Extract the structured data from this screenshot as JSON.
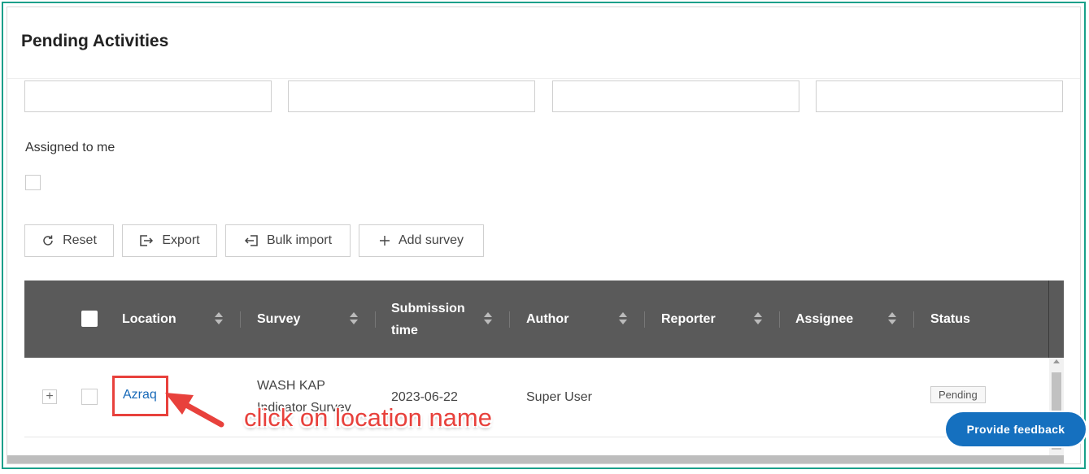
{
  "page": {
    "title": "Pending Activities"
  },
  "filters": {
    "inputs": [
      "",
      "",
      "",
      ""
    ],
    "assigned_label": "Assigned to me"
  },
  "toolbar": {
    "reset": "Reset",
    "export": "Export",
    "bulk_import": "Bulk import",
    "add_survey": "Add survey"
  },
  "table": {
    "columns": [
      "Location",
      "Survey",
      "Submission time",
      "Author",
      "Reporter",
      "Assignee",
      "Status"
    ],
    "column_lines": {
      "submission_1": "Submission",
      "submission_2": "time"
    },
    "rows": [
      {
        "location": "Azraq",
        "survey_line1": "WASH KAP",
        "survey_line2": "Indicator Survey",
        "submission_time": "2023-06-22",
        "author": "Super User",
        "reporter": "",
        "assignee": "",
        "status": "Pending"
      }
    ]
  },
  "annotation": {
    "text": "click on location name",
    "color": "#e8413c"
  },
  "feedback": {
    "label": "Provide feedback"
  },
  "colors": {
    "accent_frame": "#19a08a",
    "header_bg": "#5a5a5a",
    "link": "#1769b8",
    "feedback_bg": "#1570bf"
  }
}
